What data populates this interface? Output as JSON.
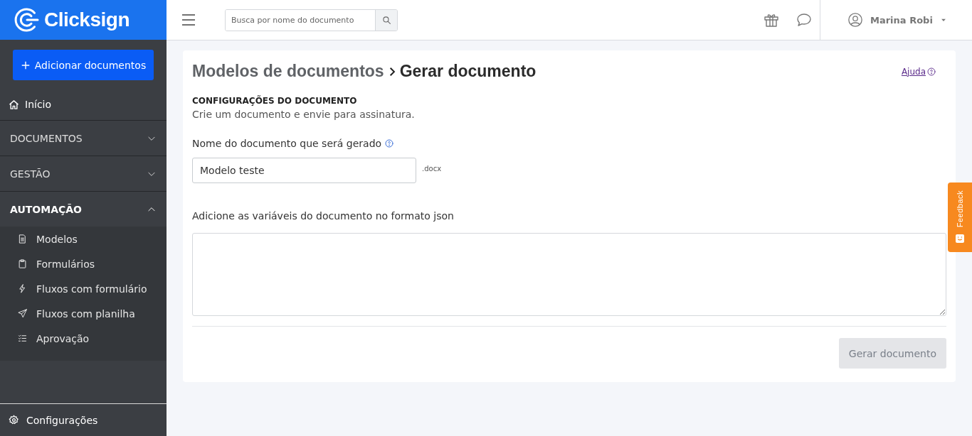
{
  "brand": {
    "name": "Clicksign"
  },
  "topbar": {
    "search_placeholder": "Busca por nome do documento",
    "user_name": "Marina Robi"
  },
  "sidebar": {
    "add_button": "Adicionar documentos",
    "nav": [
      {
        "kind": "link",
        "label": "Início"
      },
      {
        "kind": "section",
        "label": "DOCUMENTOS",
        "expanded": false
      },
      {
        "kind": "section",
        "label": "GESTÃO",
        "expanded": false
      },
      {
        "kind": "section",
        "label": "AUTOMAÇÃO",
        "expanded": true,
        "children": [
          {
            "label": "Modelos"
          },
          {
            "label": "Formulários"
          },
          {
            "label": "Fluxos com formulário"
          },
          {
            "label": "Fluxos com planilha"
          },
          {
            "label": "Aprovação"
          }
        ]
      }
    ],
    "footer": "Configurações"
  },
  "page": {
    "breadcrumb": [
      "Modelos de documentos",
      "Gerar documento"
    ],
    "help": "Ajuda",
    "section_title": "CONFIGURAÇÕES DO DOCUMENTO",
    "section_subtitle": "Crie um documento e envie para assinatura.",
    "name_label": "Nome do documento que será gerado",
    "name_value": "Modelo teste",
    "extension": ".docx",
    "variables_label": "Adicione as variáveis do documento no formato json",
    "submit": {
      "label": "Gerar documento",
      "disabled": true
    }
  },
  "feedback": "Feedback"
}
